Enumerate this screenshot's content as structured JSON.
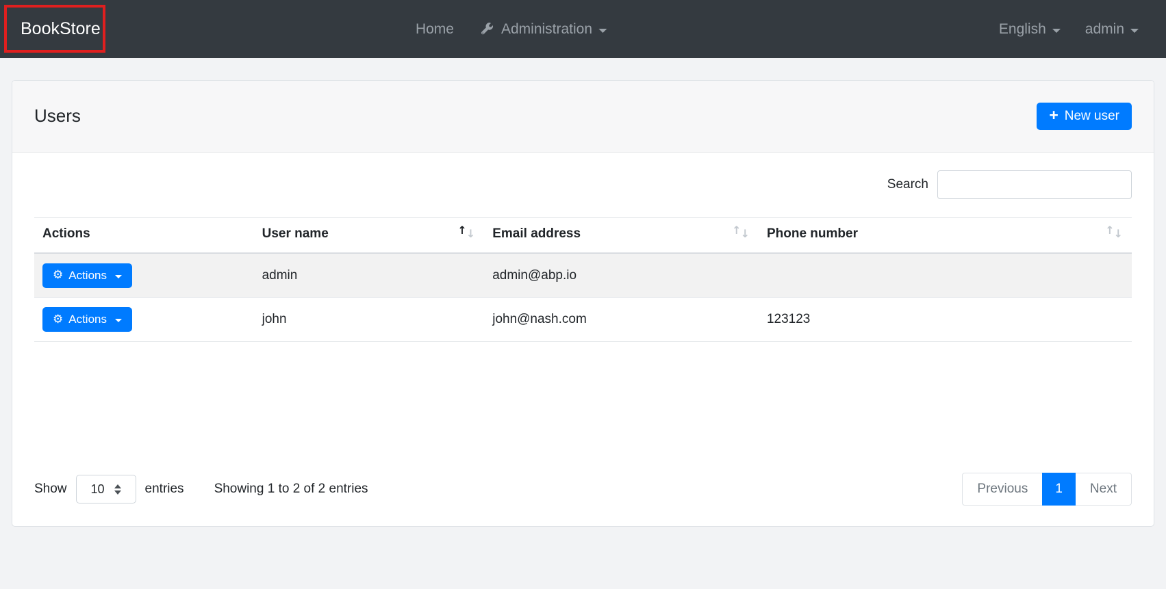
{
  "navbar": {
    "brand": "BookStore",
    "home_label": "Home",
    "administration_label": "Administration",
    "language_label": "English",
    "user_label": "admin"
  },
  "card": {
    "title": "Users",
    "new_user_label": "New user"
  },
  "search": {
    "label": "Search",
    "value": ""
  },
  "table": {
    "columns": [
      "Actions",
      "User name",
      "Email address",
      "Phone number"
    ],
    "rows": [
      {
        "action_label": "Actions",
        "user_name": "admin",
        "email": "admin@abp.io",
        "phone": ""
      },
      {
        "action_label": "Actions",
        "user_name": "john",
        "email": "john@nash.com",
        "phone": "123123"
      }
    ]
  },
  "footer": {
    "show_label": "Show",
    "page_size": "10",
    "entries_label": "entries",
    "info": "Showing 1 to 2 of 2 entries",
    "pagination": {
      "previous": "Previous",
      "current": "1",
      "next": "Next"
    }
  },
  "icons": {
    "plus": "+",
    "gear": "⚙",
    "sort_up": "↑",
    "sort_down": "↓"
  },
  "colors": {
    "primary": "#007bff",
    "navbar_bg": "#343a40",
    "annotation_red": "#e01f1f",
    "row_stripe": "#f2f2f2"
  }
}
